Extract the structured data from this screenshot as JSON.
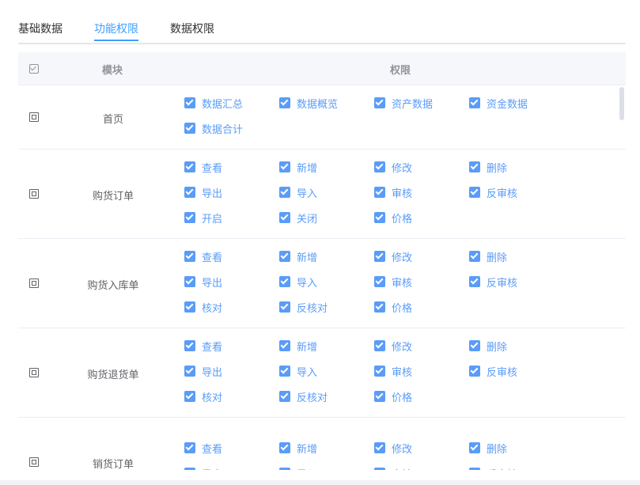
{
  "tabs": [
    {
      "label": "基础数据",
      "active": false
    },
    {
      "label": "功能权限",
      "active": true
    },
    {
      "label": "数据权限",
      "active": false
    }
  ],
  "table": {
    "header_module": "模块",
    "header_permissions": "权限",
    "rows": [
      {
        "module": "首页",
        "permissions": [
          "数据汇总",
          "数据概览",
          "资产数据",
          "资金数据",
          "数据合计"
        ]
      },
      {
        "module": "购货订单",
        "permissions": [
          "查看",
          "新增",
          "修改",
          "删除",
          "导出",
          "导入",
          "审核",
          "反审核",
          "开启",
          "关闭",
          "价格"
        ]
      },
      {
        "module": "购货入库单",
        "permissions": [
          "查看",
          "新增",
          "修改",
          "删除",
          "导出",
          "导入",
          "审核",
          "反审核",
          "核对",
          "反核对",
          "价格"
        ]
      },
      {
        "module": "购货退货单",
        "permissions": [
          "查看",
          "新增",
          "修改",
          "删除",
          "导出",
          "导入",
          "审核",
          "反审核",
          "核对",
          "反核对",
          "价格"
        ]
      },
      {
        "module": "销货订单",
        "permissions": [
          "查看",
          "新增",
          "修改",
          "删除",
          "导出",
          "导入",
          "审核",
          "反审核"
        ]
      }
    ]
  },
  "colors": {
    "accent": "#409eff",
    "checkbox": "#5a9cf8",
    "border": "#ebeef5"
  }
}
